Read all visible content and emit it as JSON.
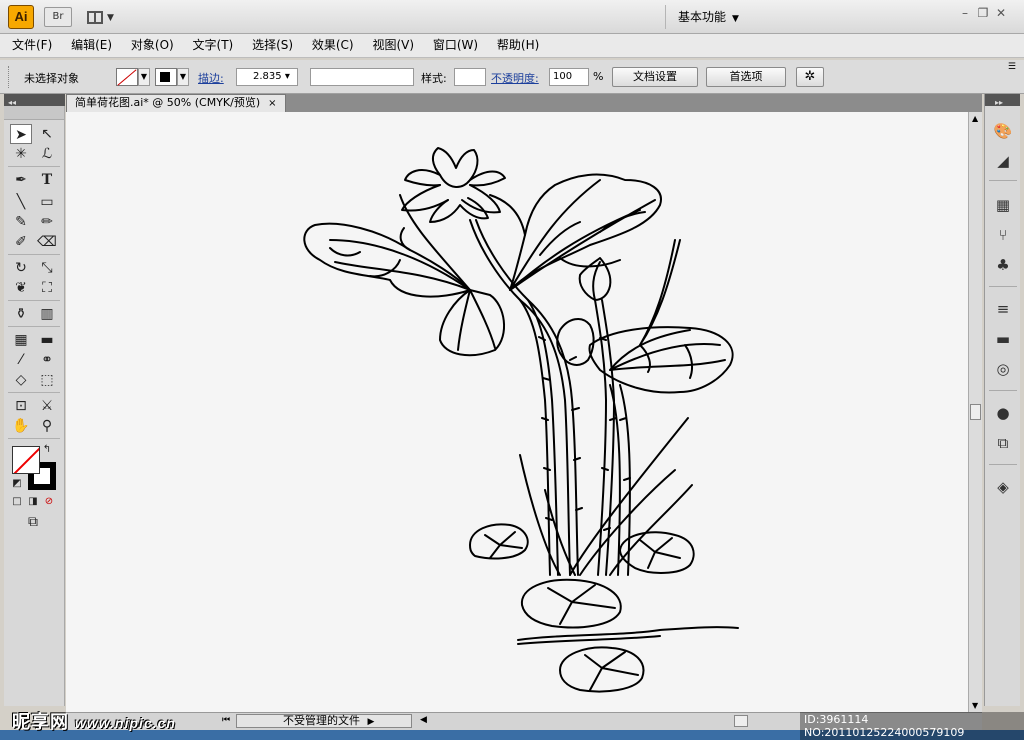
{
  "app": {
    "logo": "Ai",
    "bridge": "Br",
    "workspace": "基本功能"
  },
  "menu": [
    "文件(F)",
    "编辑(E)",
    "对象(O)",
    "文字(T)",
    "选择(S)",
    "效果(C)",
    "视图(V)",
    "窗口(W)",
    "帮助(H)"
  ],
  "control": {
    "selection": "未选择对象",
    "stroke_label": "描边:",
    "stroke_value": "2.835",
    "style_label": "样式:",
    "opacity_label": "不透明度:",
    "opacity_value": "100",
    "opacity_unit": "%",
    "doc_setup": "文档设置",
    "prefs": "首选项"
  },
  "document": {
    "tab_title": "简单荷花图.ai* @ 50% (CMYK/预览)",
    "close": "×"
  },
  "status": {
    "file_state": "不受管理的文件"
  },
  "watermark": {
    "site_cn": "昵享网",
    "site_url": "www.nipic.cn",
    "id_text": "ID:3961114 NO:20110125224000579109"
  },
  "icons": {
    "minimize": "minimize-icon",
    "restore": "restore-icon",
    "close": "close-icon"
  }
}
